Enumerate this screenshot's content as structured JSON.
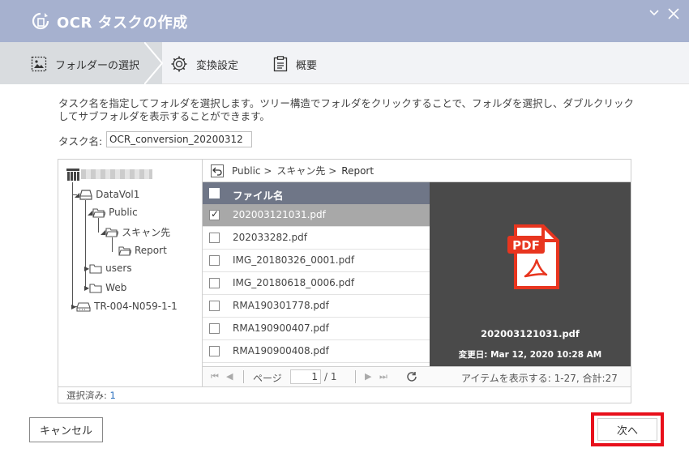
{
  "window": {
    "title": "OCR タスクの作成"
  },
  "steps": [
    {
      "label": "フォルダーの選択",
      "icon": "image-folder-icon",
      "active": true
    },
    {
      "label": "変換設定",
      "icon": "gear-icon",
      "active": false
    },
    {
      "label": "概要",
      "icon": "clipboard-icon",
      "active": false
    }
  ],
  "instructions": "タスク名を指定してフォルダを選択します。ツリー構造でフォルダをクリックすることで、フォルダを選択し、ダブルクリックしてサブフォルダを表示することができます。",
  "task_name": {
    "label": "タスク名:",
    "value": "OCR_conversion_20200312"
  },
  "tree": {
    "items": [
      {
        "label": "DataVol1",
        "icon": "drive-icon"
      },
      {
        "label": "Public",
        "icon": "folder-open-icon"
      },
      {
        "label": "スキャン先",
        "icon": "folder-open-icon"
      },
      {
        "label": "Report",
        "icon": "folder-open-icon"
      },
      {
        "label": "users",
        "icon": "folder-icon"
      },
      {
        "label": "Web",
        "icon": "folder-icon"
      },
      {
        "label": "TR-004-N059-1-1",
        "icon": "external-drive-icon"
      }
    ]
  },
  "breadcrumb": {
    "parts": [
      "Public >",
      "スキャン先 >",
      "Report"
    ]
  },
  "file_list": {
    "header": "ファイル名",
    "files": [
      {
        "name": "202003121031.pdf",
        "checked": true
      },
      {
        "name": "202033282.pdf",
        "checked": false
      },
      {
        "name": "IMG_20180326_0001.pdf",
        "checked": false
      },
      {
        "name": "IMG_20180618_0006.pdf",
        "checked": false
      },
      {
        "name": "RMA190301778.pdf",
        "checked": false
      },
      {
        "name": "RMA190900407.pdf",
        "checked": false
      },
      {
        "name": "RMA190900408.pdf",
        "checked": false
      }
    ]
  },
  "pager": {
    "page_label": "ページ",
    "page_value": "1",
    "page_total": "/ 1",
    "items_text": "アイテムを表示する: 1-27, 合計:27"
  },
  "preview": {
    "icon_label": "PDF",
    "filename": "202003121031.pdf",
    "modified": "変更日: Mar 12, 2020 10:28 AM"
  },
  "footer": {
    "selected_label": "選択済み:",
    "selected_count": "1"
  },
  "buttons": {
    "cancel": "キャンセル",
    "next": "次へ"
  },
  "colors": {
    "titlebar": "#a6b1cf",
    "highlight_border": "#e8101b",
    "pdf_red": "#e8351f",
    "table_header": "#6f7687"
  }
}
